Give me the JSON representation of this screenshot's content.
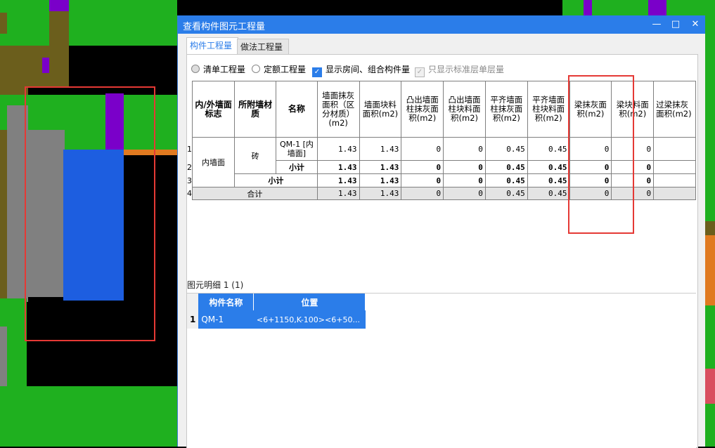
{
  "colors": {
    "cad_green": "#1fb01f",
    "cad_olive": "#6b5e1c",
    "cad_purple": "#7a00c9",
    "cad_gray": "#808080",
    "cad_blue": "#1d5ee0",
    "cad_orange": "#e07a20",
    "title_blue": "#2b7de9",
    "highlight_red": "#e53935"
  },
  "window": {
    "title": "查看构件图元工程量",
    "minimize_glyph": "—",
    "maximize_glyph": "□",
    "close_glyph": "✕"
  },
  "tabs": [
    {
      "label": "构件工程量",
      "active": true
    },
    {
      "label": "做法工程量",
      "active": false
    }
  ],
  "options": {
    "radio_qingdan": "清单工程量",
    "radio_dinge": "定额工程量",
    "check_room": "显示房间、组合构件量",
    "check_std_floor": "只显示标准层单层量",
    "check_mark": "✓"
  },
  "quantity_table": {
    "headers": [
      "内/外墙面标志",
      "所附墙材质",
      "名称",
      "墙面抹灰面积（区分材质）(m2)",
      "墙面块料面积(m2)",
      "凸出墙面柱抹灰面积(m2)",
      "凸出墙面柱块料面积(m2)",
      "平齐墙面柱抹灰面积(m2)",
      "平齐墙面柱块料面积(m2)",
      "梁抹灰面积(m2)",
      "梁块料面积(m2)",
      "过梁抹灰面积(m2)"
    ],
    "row_numbers": [
      "1",
      "2",
      "3",
      "4"
    ],
    "group_label": "内墙面",
    "material": "砖",
    "row1_name": "QM-1 [内墙面]",
    "subtotal_label": "小计",
    "total_label": "合计",
    "row1_values": [
      "1.43",
      "1.43",
      "0",
      "0",
      "0.45",
      "0.45",
      "0",
      "0",
      ""
    ],
    "row2_values": [
      "1.43",
      "1.43",
      "0",
      "0",
      "0.45",
      "0.45",
      "0",
      "0",
      ""
    ],
    "row3_values": [
      "1.43",
      "1.43",
      "0",
      "0",
      "0.45",
      "0.45",
      "0",
      "0",
      ""
    ],
    "row4_values": [
      "1.43",
      "1.43",
      "0",
      "0",
      "0.45",
      "0.45",
      "0",
      "0",
      ""
    ]
  },
  "detail": {
    "title": "图元明细  1 (1)",
    "headers": [
      "构件名称",
      "位置"
    ],
    "rows": [
      {
        "num": "1",
        "name": "QM-1",
        "position": "<6+1150,K-100><6+50..."
      }
    ]
  }
}
